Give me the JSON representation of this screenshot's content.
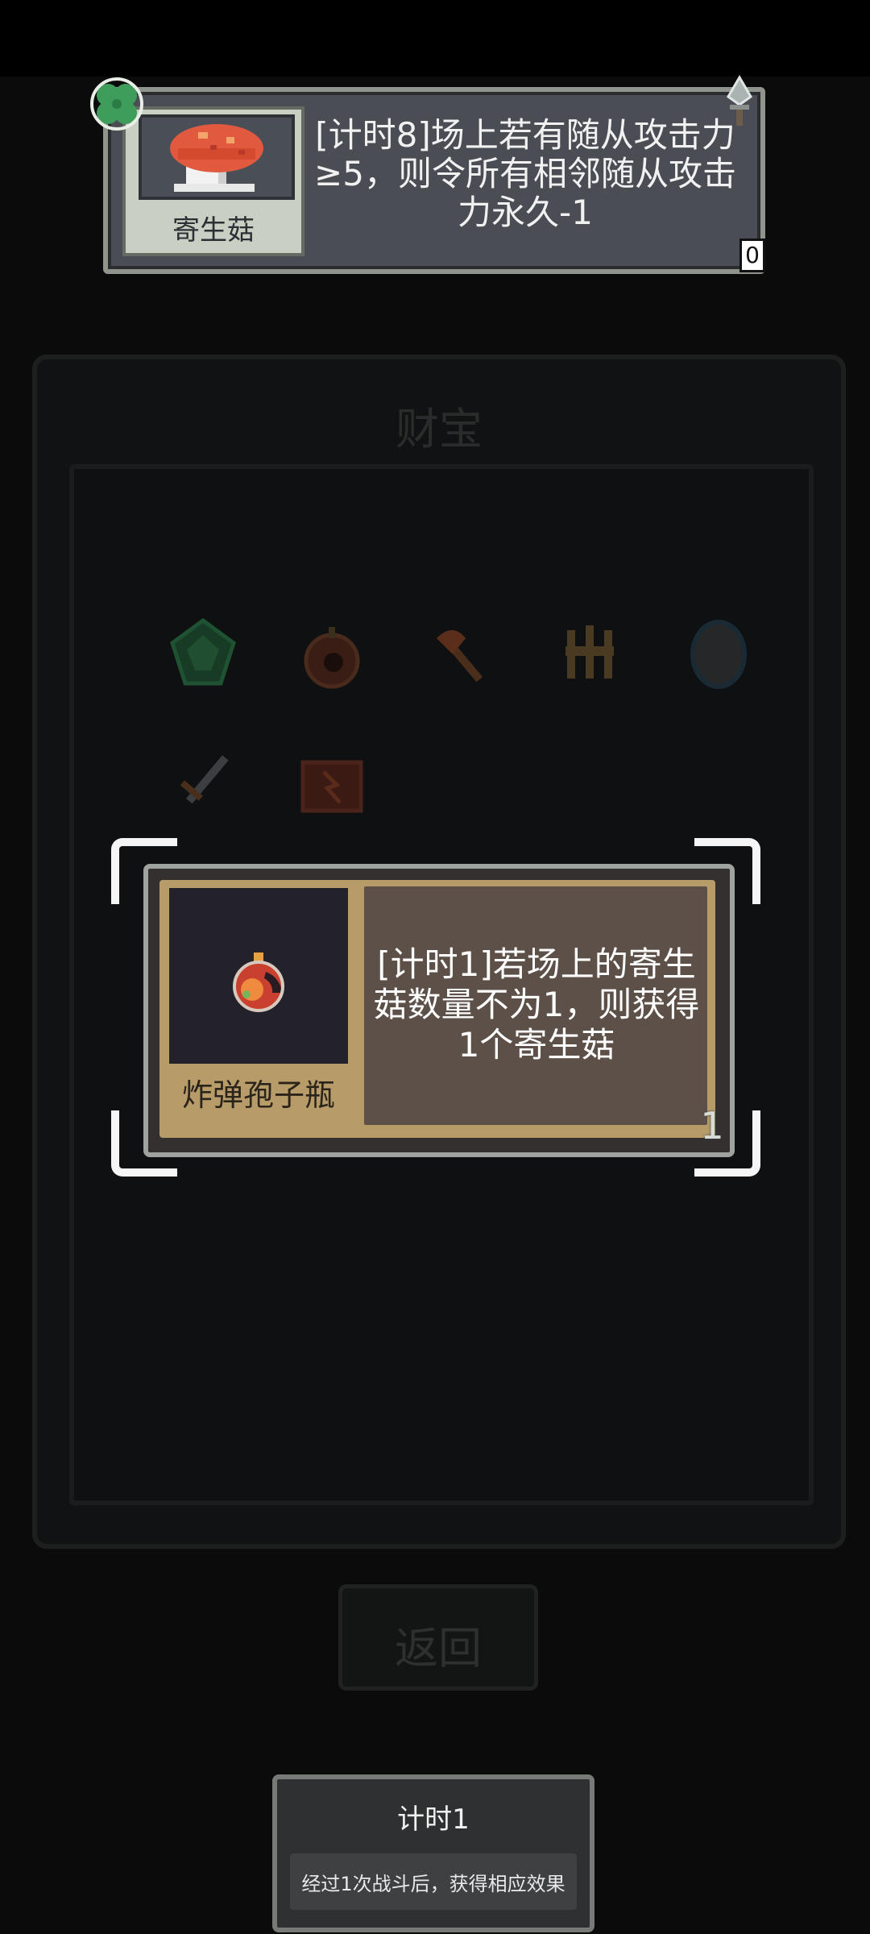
{
  "minion_card": {
    "name": "寄生菇",
    "description": "[计时8]场上若有随从攻击力≥5，则令所有相邻随从攻击力永久-1",
    "count": "0",
    "icons": [
      "clover-icon",
      "dagger-icon",
      "mushroom-icon"
    ]
  },
  "treasure_panel": {
    "title": "财宝",
    "items": [
      "emerald-icon",
      "bomb-icon",
      "axe-icon",
      "claw-icon",
      "stone-icon",
      "sword-icon",
      "chest-icon"
    ]
  },
  "treasure_card": {
    "name": "炸弹孢子瓶",
    "description": "[计时1]若场上的寄生菇数量不为1，则获得1个寄生菇",
    "count": "1",
    "icon": "spore-bomb-icon"
  },
  "buttons": {
    "return_label": "返回"
  },
  "tooltip": {
    "title": "计时1",
    "body": "经过1次战斗后，获得相应效果"
  },
  "colors": {
    "background": "#0b0b0b",
    "card_frame": "#b79c6a",
    "card_desc_bg": "#5c5048",
    "minion_bg": "#4b4d55"
  }
}
